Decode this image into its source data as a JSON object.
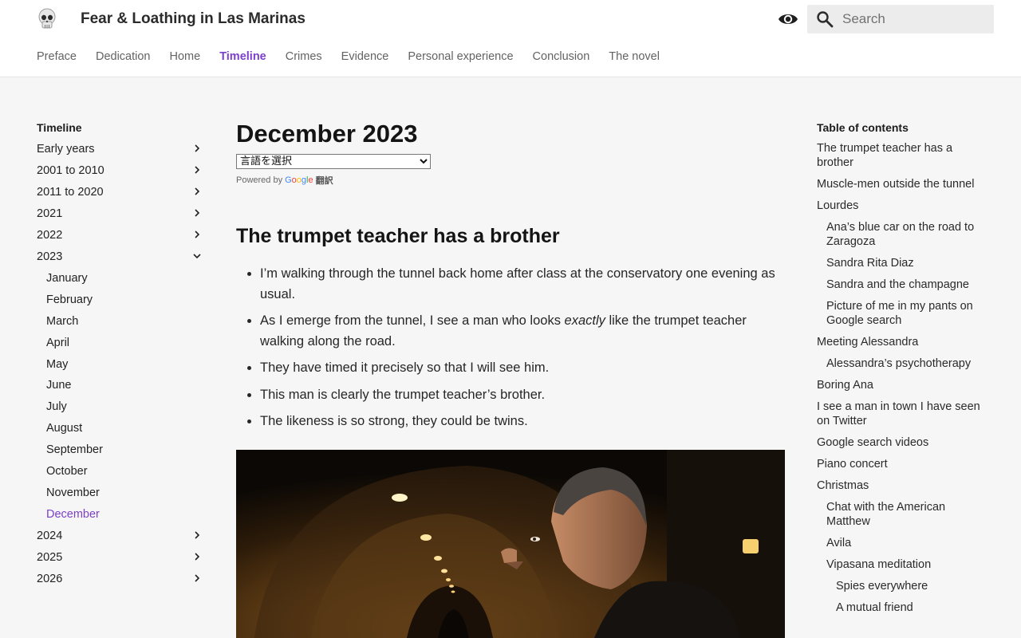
{
  "header": {
    "title": "Fear & Loathing in Las Marinas",
    "logo_icon": "skull-icon",
    "search_placeholder": "Search"
  },
  "tabs": [
    {
      "label": "Preface"
    },
    {
      "label": "Dedication"
    },
    {
      "label": "Home"
    },
    {
      "label": "Timeline",
      "active": true
    },
    {
      "label": "Crimes"
    },
    {
      "label": "Evidence"
    },
    {
      "label": "Personal experience"
    },
    {
      "label": "Conclusion"
    },
    {
      "label": "The novel"
    }
  ],
  "leftnav": {
    "title": "Timeline",
    "items": [
      {
        "label": "Early years"
      },
      {
        "label": "2001 to 2010"
      },
      {
        "label": "2011 to 2020"
      },
      {
        "label": "2021"
      },
      {
        "label": "2022"
      },
      {
        "label": "2023",
        "expanded": true
      },
      {
        "label": "2024"
      },
      {
        "label": "2025"
      },
      {
        "label": "2026"
      }
    ],
    "months": [
      "January",
      "February",
      "March",
      "April",
      "May",
      "June",
      "July",
      "August",
      "September",
      "October",
      "November",
      "December"
    ],
    "current_month": "December"
  },
  "main": {
    "title": "December 2023",
    "language_select": "言語を選択",
    "powered_by": "Powered by",
    "google": [
      "G",
      "o",
      "o",
      "g",
      "l",
      "e"
    ],
    "translate": "翻訳",
    "section_title": "The trumpet teacher has a brother",
    "bullets": [
      {
        "before": "I’m walking through the tunnel back home after class at the conservatory one evening as usual.",
        "em": "",
        "after": ""
      },
      {
        "before": "As I emerge from the tunnel, I see a man who looks ",
        "em": "exactly",
        "after": " like the trumpet teacher walking along the road."
      },
      {
        "before": "They have timed it precisely so that I will see him.",
        "em": "",
        "after": ""
      },
      {
        "before": "This man is clearly the trumpet teacher’s brother.",
        "em": "",
        "after": ""
      },
      {
        "before": "The likeness is so strong, they could be twins.",
        "em": "",
        "after": ""
      }
    ]
  },
  "toc": {
    "title": "Table of contents",
    "items": [
      {
        "label": "The trumpet teacher has a brother",
        "level": 1
      },
      {
        "label": "Muscle-men outside the tunnel",
        "level": 1
      },
      {
        "label": "Lourdes",
        "level": 1
      },
      {
        "label": "Ana’s blue car on the road to Zaragoza",
        "level": 2
      },
      {
        "label": "Sandra Rita Diaz",
        "level": 2
      },
      {
        "label": "Sandra and the champagne",
        "level": 2
      },
      {
        "label": "Picture of me in my pants on Google search",
        "level": 2
      },
      {
        "label": "Meeting Alessandra",
        "level": 1
      },
      {
        "label": "Alessandra’s psychotherapy",
        "level": 2
      },
      {
        "label": "Boring Ana",
        "level": 1
      },
      {
        "label": "I see a man in town I have seen on Twitter",
        "level": 1
      },
      {
        "label": "Google search videos",
        "level": 1
      },
      {
        "label": "Piano concert",
        "level": 1
      },
      {
        "label": "Christmas",
        "level": 1
      },
      {
        "label": "Chat with the American Matthew",
        "level": 2
      },
      {
        "label": "Avila",
        "level": 2
      },
      {
        "label": "Vipasana meditation",
        "level": 2
      },
      {
        "label": "Spies everywhere",
        "level": 3
      },
      {
        "label": "A mutual friend",
        "level": 3
      }
    ]
  },
  "colors": {
    "accent": "#7b3fc9",
    "background": "#f6f6f6",
    "header": "#ffffff"
  }
}
